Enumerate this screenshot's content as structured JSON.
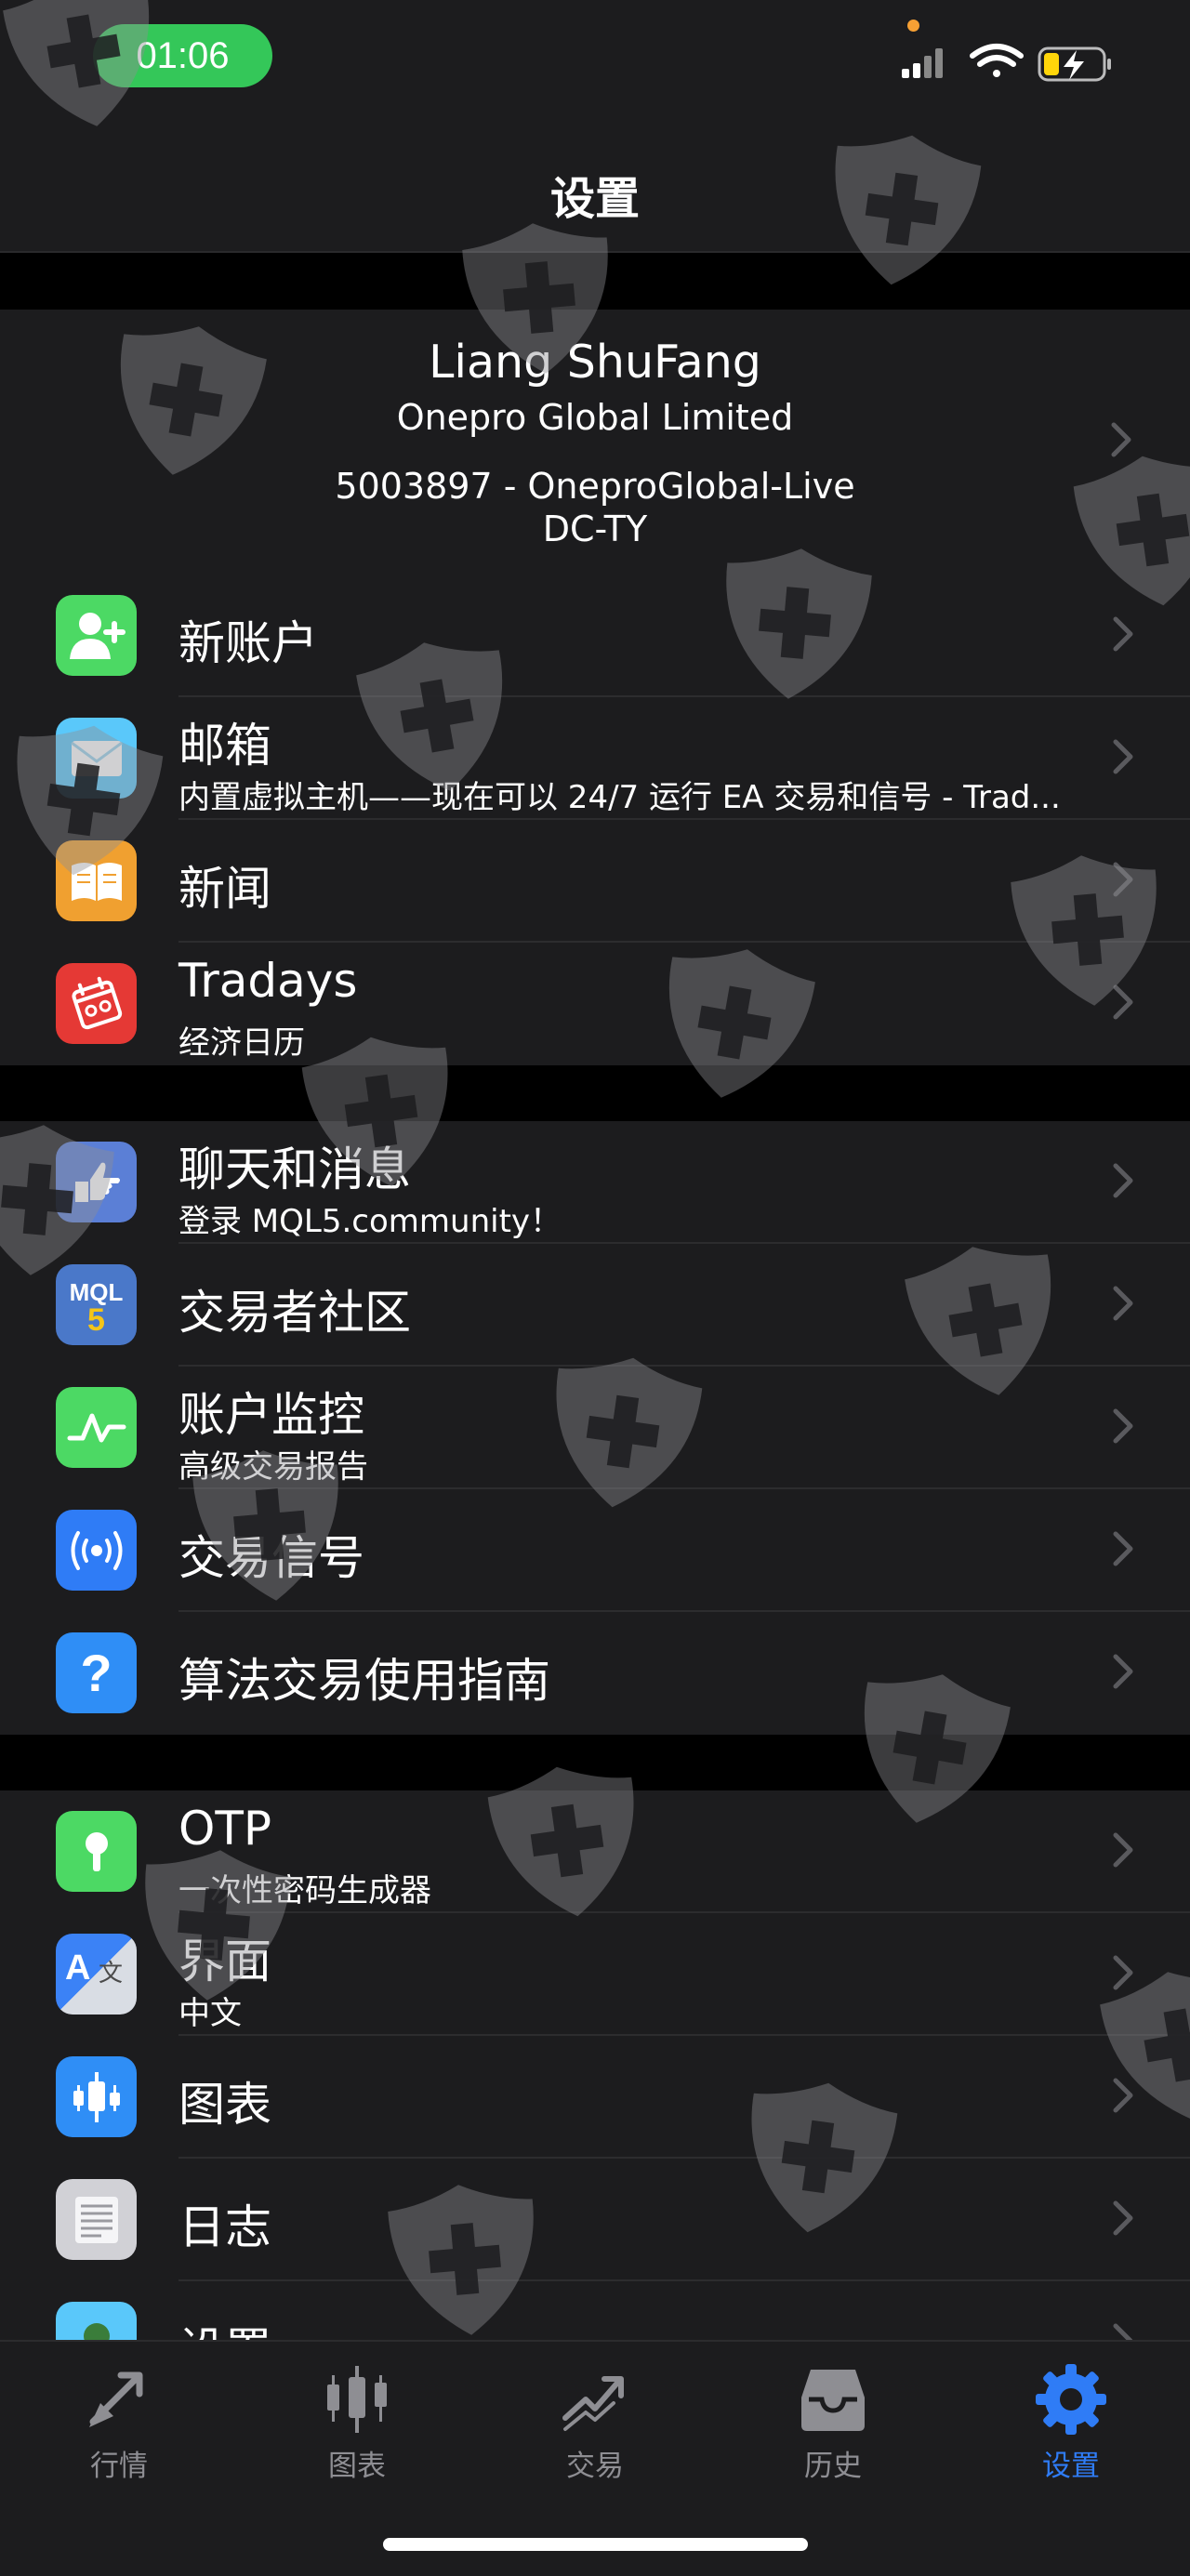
{
  "status_bar": {
    "time": "01:06",
    "icons": [
      "cellular-signal-icon",
      "wifi-icon",
      "battery-charging-icon"
    ]
  },
  "header": {
    "title": "设置"
  },
  "account": {
    "name": "Liang ShuFang",
    "company": "Onepro Global Limited",
    "number_line": "5003897 - OneproGlobal-Live",
    "server": "DC-TY"
  },
  "section1": [
    {
      "title": "新账户",
      "icon": "add-user-icon",
      "color": "#4cd964"
    },
    {
      "title": "邮箱",
      "subtitle": "内置虚拟主机——现在可以 24/7 运行 EA 交易和信号 - Trad...",
      "icon": "mail-icon",
      "color": "#5ac8fa"
    },
    {
      "title": "新闻",
      "icon": "book-icon",
      "color": "#f0a030"
    },
    {
      "title": "Tradays",
      "subtitle": "经济日历",
      "icon": "calendar-icon",
      "color": "#e53935"
    }
  ],
  "section2": [
    {
      "title": "聊天和消息",
      "subtitle": "登录 MQL5.community！",
      "icon": "chat-hand-icon",
      "color": "#5b7fd6"
    },
    {
      "title": "交易者社区",
      "icon": "mql5-icon",
      "color": "#4a78c9",
      "icon_text": "MQL",
      "icon_digit": "5"
    },
    {
      "title": "账户监控",
      "subtitle": "高级交易报告",
      "icon": "monitoring-icon",
      "color": "#4cd964"
    },
    {
      "title": "交易信号",
      "icon": "signal-broadcast-icon",
      "color": "#2f7cf6"
    },
    {
      "title": "算法交易使用指南",
      "icon": "question-icon",
      "color": "#2f8ef6",
      "icon_text": "?"
    }
  ],
  "section3": [
    {
      "title": "OTP",
      "subtitle": "一次性密码生成器",
      "icon": "key-icon",
      "color": "#4cd964"
    },
    {
      "title": "界面",
      "subtitle": "中文",
      "icon": "language-icon",
      "color": "#3b82f6",
      "icon_text": "A",
      "icon_text2": "文"
    },
    {
      "title": "图表",
      "icon": "candlestick-icon",
      "color": "#2f8ef6"
    },
    {
      "title": "日志",
      "icon": "log-icon",
      "color": "#d1d1d6"
    },
    {
      "title": "设置",
      "icon": "settings-avatar-icon",
      "color": "#5ac8fa"
    }
  ],
  "tabs": [
    {
      "label": "行情",
      "icon": "quotes-arrows-icon",
      "active": false
    },
    {
      "label": "图表",
      "icon": "chart-candles-icon",
      "active": false
    },
    {
      "label": "交易",
      "icon": "trade-trend-icon",
      "active": false
    },
    {
      "label": "历史",
      "icon": "history-inbox-icon",
      "active": false
    },
    {
      "label": "设置",
      "icon": "settings-gear-icon",
      "active": true
    }
  ],
  "colors": {
    "accent": "#2f7cf6",
    "background": "#000000",
    "cell": "#1c1c1e",
    "inactive": "#8e8e93"
  }
}
